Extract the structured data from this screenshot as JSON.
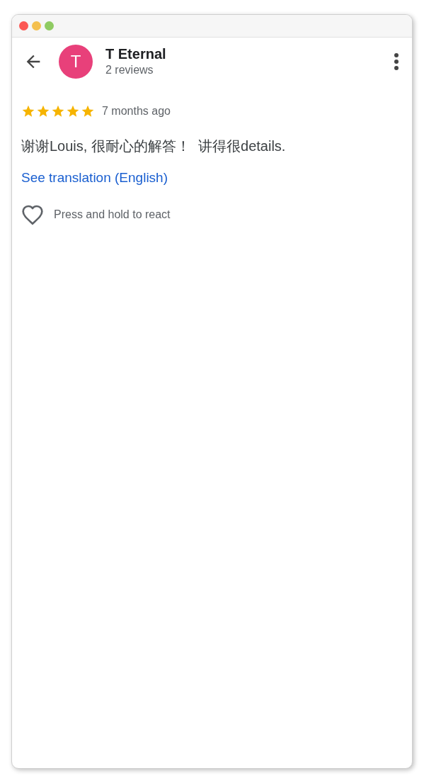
{
  "reviewer": {
    "avatar_letter": "T",
    "name": "T Eternal",
    "reviews": "2 reviews"
  },
  "review": {
    "stars": 5,
    "time": "7 months ago",
    "text": "谢谢Louis, 很耐心的解答！  讲得很details.",
    "translation_link": "See translation (English)",
    "react_hint": "Press and hold to react"
  }
}
